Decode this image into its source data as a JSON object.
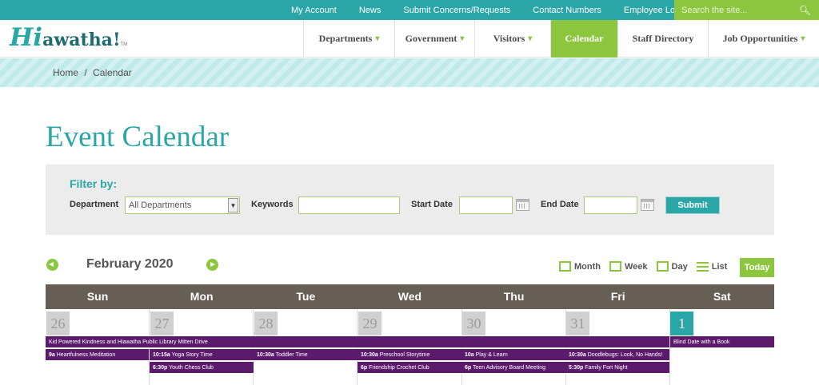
{
  "topbar": {
    "links": [
      "My Account",
      "News",
      "Submit Concerns/Requests",
      "Contact Numbers",
      "Employee Login"
    ],
    "search_placeholder": "Search the site..."
  },
  "logo": {
    "hi": "Hi",
    "rest": "awatha!",
    "tm": "TM"
  },
  "nav": [
    {
      "label": "Departments",
      "dropdown": true
    },
    {
      "label": "Government",
      "dropdown": true
    },
    {
      "label": "Visitors",
      "dropdown": true
    },
    {
      "label": "Calendar",
      "dropdown": false
    },
    {
      "label": "Staff Directory",
      "dropdown": false
    },
    {
      "label": "Job Opportunities",
      "dropdown": true
    }
  ],
  "breadcrumb": {
    "home": "Home",
    "sep": "/",
    "current": "Calendar"
  },
  "page_title": "Event Calendar",
  "filter": {
    "heading": "Filter by:",
    "department_label": "Department",
    "department_value": "All Departments",
    "keywords_label": "Keywords",
    "start_label": "Start Date",
    "end_label": "End Date",
    "submit": "Submit"
  },
  "calendar": {
    "month": "February 2020",
    "views": [
      "Month",
      "Week",
      "Day",
      "List"
    ],
    "today": "Today",
    "days": [
      "Sun",
      "Mon",
      "Tue",
      "Wed",
      "Thu",
      "Fri",
      "Sat"
    ],
    "dates": [
      "26",
      "27",
      "28",
      "29",
      "30",
      "31",
      "1"
    ],
    "spanning_event": "Kid Powered Kindness and Hiawatha Public Library Mitten Drive",
    "sat_event": "Blind Date with a Book",
    "events": {
      "sun": [
        {
          "time": "9a",
          "title": "Heartfulness Meditation"
        }
      ],
      "mon": [
        {
          "time": "10:15a",
          "title": "Yoga Story Time"
        },
        {
          "time": "6:30p",
          "title": "Youth Chess Club"
        }
      ],
      "tue": [
        {
          "time": "10:30a",
          "title": "Toddler Time"
        }
      ],
      "wed": [
        {
          "time": "10:30a",
          "title": "Preschool Storytime"
        },
        {
          "time": "6p",
          "title": "Friendship Crochet Club"
        }
      ],
      "thu": [
        {
          "time": "10a",
          "title": "Play & Learn"
        },
        {
          "time": "6p",
          "title": "Teen Advisory Board Meeting"
        }
      ],
      "fri": [
        {
          "time": "10:30a",
          "title": "Doodlebugs: Look, No Hands!"
        },
        {
          "time": "5:30p",
          "title": "Family Fort Night"
        }
      ]
    }
  },
  "colors": {
    "teal": "#2aa6a6",
    "green": "#8cc63f",
    "purple": "#5b1a6b",
    "header_brown": "#675e56"
  }
}
